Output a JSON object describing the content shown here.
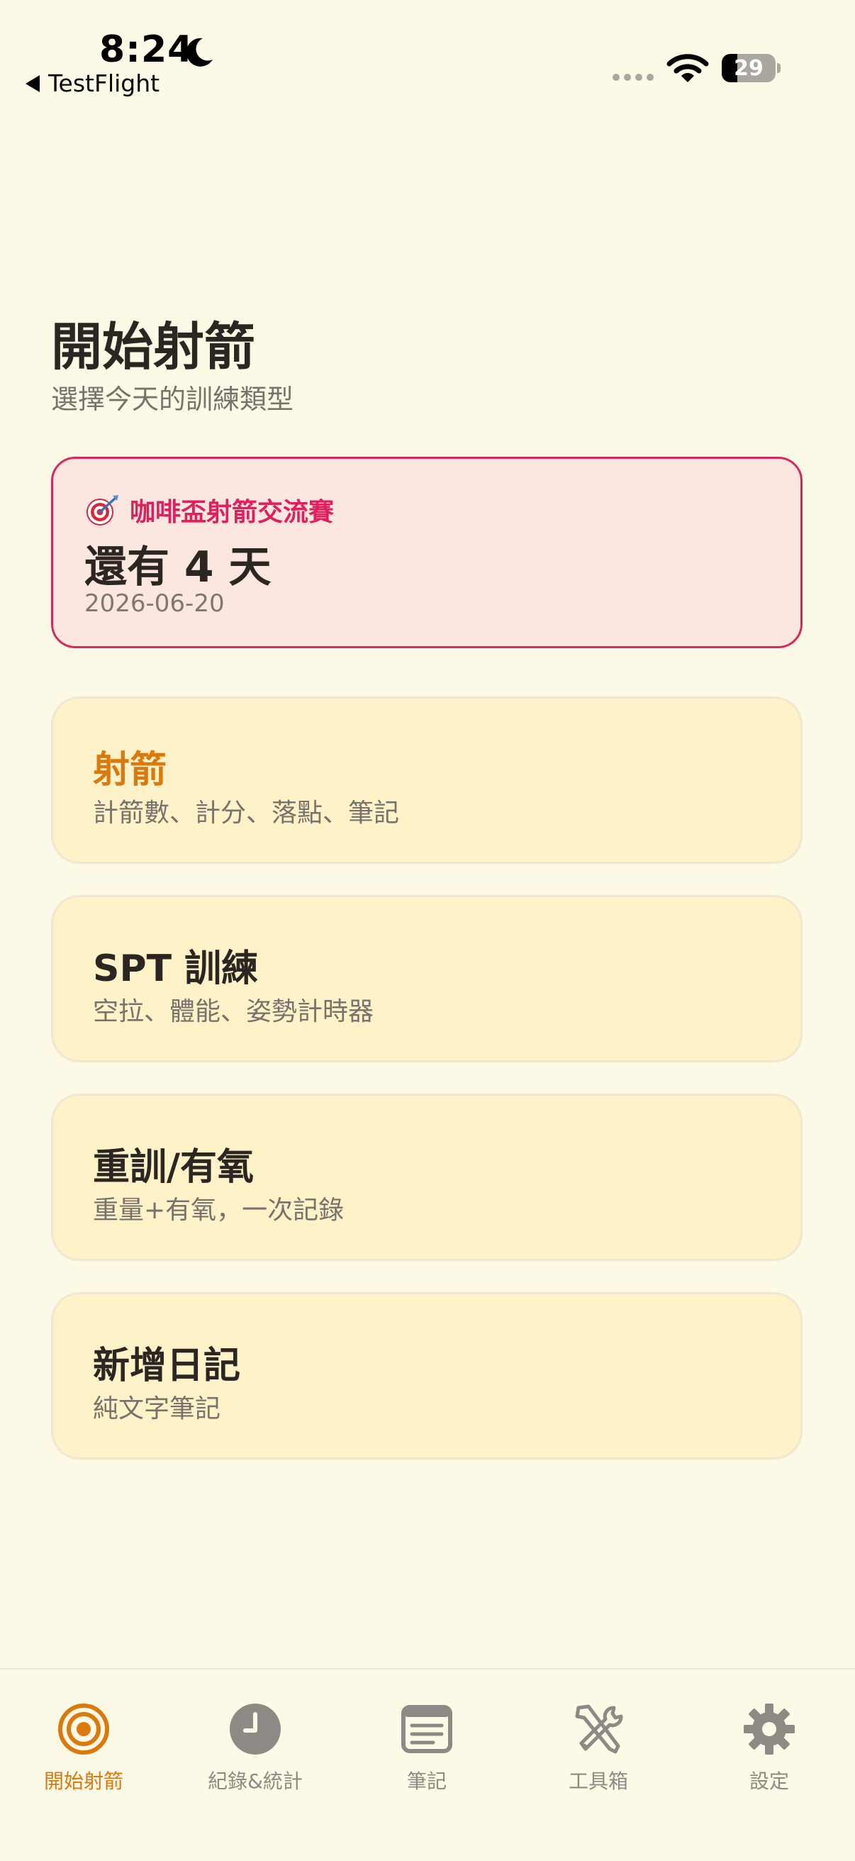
{
  "status_bar": {
    "time": "8:24",
    "back_app": "TestFlight",
    "battery": "29",
    "battery_level": 0.29
  },
  "header": {
    "title": "開始射箭",
    "subtitle": "選擇今天的訓練類型"
  },
  "countdown": {
    "event_name": "咖啡盃射箭交流賽",
    "remaining": "還有 4 天",
    "date": "2026-06-20"
  },
  "options": [
    {
      "title": "射箭",
      "desc": "計箭數、計分、落點、筆記"
    },
    {
      "title": "SPT 訓練",
      "desc": "空拉、體能、姿勢計時器"
    },
    {
      "title": "重訓/有氧",
      "desc": "重量+有氧，一次記錄"
    },
    {
      "title": "新增日記",
      "desc": "純文字筆記"
    }
  ],
  "tabs": [
    {
      "label": "開始射箭",
      "icon": "target-icon",
      "active": true
    },
    {
      "label": "紀錄&統計",
      "icon": "clock-icon",
      "active": false
    },
    {
      "label": "筆記",
      "icon": "notes-icon",
      "active": false
    },
    {
      "label": "工具箱",
      "icon": "tools-icon",
      "active": false
    },
    {
      "label": "設定",
      "icon": "gear-icon",
      "active": false
    }
  ],
  "colors": {
    "background": "#FDF9E7",
    "accent": "#D9790E",
    "countdown_border": "#D7285E",
    "countdown_text": "#E0205E",
    "card_background": "#FEF2C8",
    "tab_inactive": "#8D8A85"
  }
}
